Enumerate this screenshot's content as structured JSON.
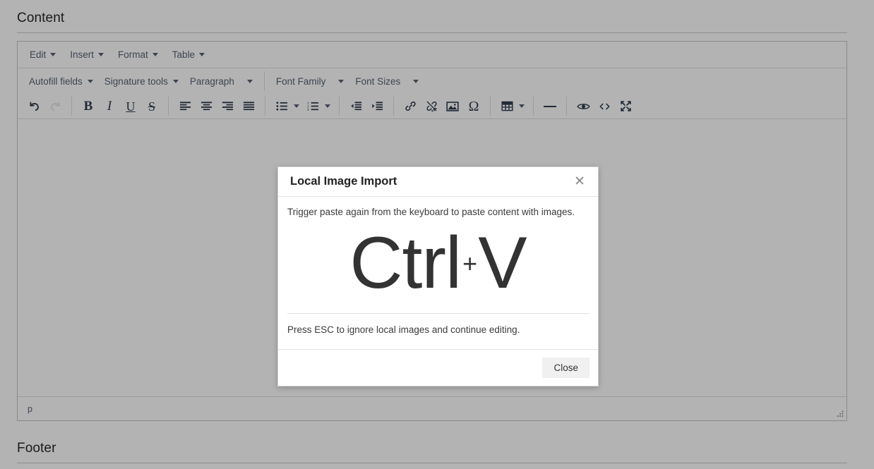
{
  "sections": {
    "content_heading": "Content",
    "footer_heading": "Footer"
  },
  "editor": {
    "menubar": [
      {
        "name": "edit",
        "label": "Edit"
      },
      {
        "name": "insert",
        "label": "Insert"
      },
      {
        "name": "format",
        "label": "Format"
      },
      {
        "name": "table",
        "label": "Table"
      }
    ],
    "toolbar_row1": [
      {
        "name": "autofill-fields",
        "label": "Autofill fields",
        "caret": true
      },
      {
        "name": "signature-tools",
        "label": "Signature tools",
        "caret": true
      },
      {
        "name": "paragraph",
        "label": "Paragraph",
        "caret": true
      },
      {
        "name": "font-family",
        "label": "Font Family",
        "caret": true
      },
      {
        "name": "font-sizes",
        "label": "Font Sizes",
        "caret": true
      }
    ],
    "toolbar_row2_icons": [
      "undo-icon",
      "redo-icon",
      "bold-icon",
      "italic-icon",
      "underline-icon",
      "strikethrough-icon",
      "align-left-icon",
      "align-center-icon",
      "align-right-icon",
      "align-justify-icon",
      "bullet-list-icon",
      "numbered-list-icon",
      "outdent-icon",
      "indent-icon",
      "link-icon",
      "unlink-icon",
      "image-icon",
      "special-character-icon",
      "table-icon",
      "horizontal-rule-icon",
      "preview-icon",
      "source-code-icon",
      "fullscreen-icon"
    ],
    "statusbar_path": "p",
    "resize_handle": "resize-grip-icon"
  },
  "modal": {
    "title": "Local Image Import",
    "close_icon": "close-icon",
    "note_top": "Trigger paste again from the keyboard to paste content with images.",
    "shortcut": {
      "key1": "Ctrl",
      "plus": "+",
      "key2": "V"
    },
    "note_bottom": "Press ESC to ignore local images and continue editing.",
    "close_button": "Close"
  },
  "colors": {
    "backdrop": "#b3b3b3",
    "modal_bg": "#ffffff",
    "text": "#333333",
    "button_bg": "#f0f0f0"
  }
}
